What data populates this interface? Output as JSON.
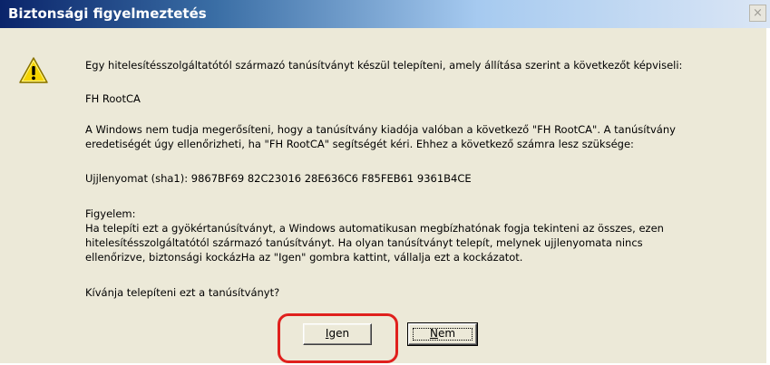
{
  "window": {
    "title": "Biztonsági figyelmeztetés",
    "close_icon": "close-icon",
    "close_glyph": "×"
  },
  "icon": {
    "name": "warning-icon",
    "glyph": "!"
  },
  "message": {
    "intro": "Egy hitelesítésszolgáltatótól származó tanúsítványt készül telepíteni, amely állítása szerint a következőt képviseli:",
    "ca_name": "FH RootCA",
    "verify_line1": "A Windows nem tudja megerősíteni, hogy a tanúsítvány kiadója valóban a következő \"FH RootCA\". A tanúsítvány",
    "verify_line2": "eredetiségét úgy ellenőrizheti, ha \"FH RootCA\" segítségét kéri. Ehhez a következő számra lesz szüksége:",
    "thumbprint": "Ujjlenyomat (sha1): 9867BF69 82C23016 28E636C6 F85FEB61 9361B4CE",
    "warning_title": "Figyelem:",
    "warning_line1": "Ha telepíti ezt a gyökértanúsítványt, a Windows automatikusan megbízhatónak fogja tekinteni az összes, ezen",
    "warning_line2": "hitelesítésszolgáltatótól származó tanúsítványt. Ha olyan tanúsítványt telepít, melynek ujjlenyomata nincs",
    "warning_line3": "ellenőrizve, biztonsági kockázHa az \"Igen\" gombra kattint, vállalja ezt a kockázatot.",
    "question": "Kívánja telepíteni ezt a tanúsítványt?"
  },
  "buttons": {
    "yes_first": "I",
    "yes_rest": "gen",
    "no_first": "N",
    "no_rest": "em"
  },
  "colors": {
    "dialog_bg": "#ece9d8",
    "title_text": "#ffffff",
    "highlight": "#e0201d"
  }
}
